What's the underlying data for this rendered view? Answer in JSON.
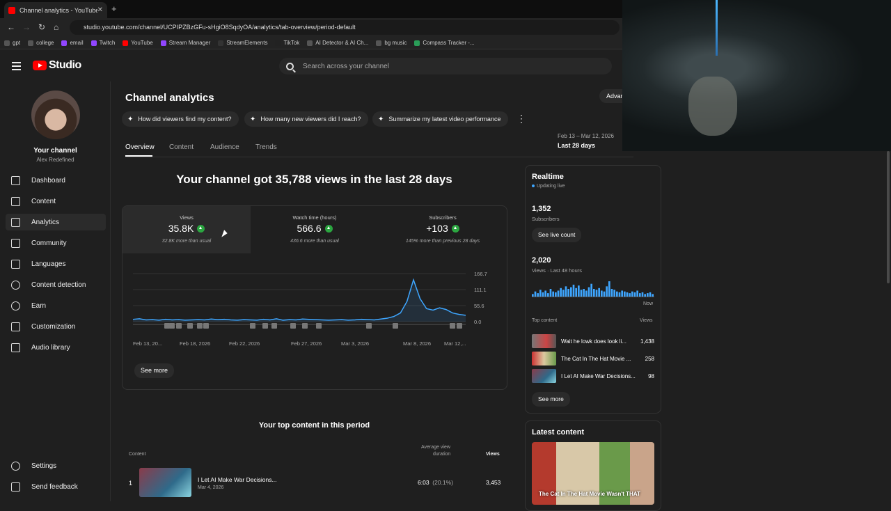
{
  "browser": {
    "tab_title": "Channel analytics - YouTube St...",
    "tab_close": "✕",
    "new_tab": "+",
    "url": "studio.youtube.com/channel/UCPIPZBzGFu-sHgiO8SqdyOA/analytics/tab-overview/period-default",
    "bookmarks": [
      "gpt",
      "college",
      "email",
      "Twitch",
      "YouTube",
      "Stream Manager",
      "StreamElements",
      "TikTok",
      "AI Detector & AI Ch...",
      "bg music",
      "Compass Tracker -..."
    ]
  },
  "header": {
    "logo_text": "Studio",
    "search_placeholder": "Search across your channel",
    "advanced_label": "Advan"
  },
  "sidebar": {
    "channel_title": "Your channel",
    "channel_name": "Alex Redefined",
    "items": [
      {
        "label": "Dashboard",
        "icon": "dashboard-icon"
      },
      {
        "label": "Content",
        "icon": "content-icon"
      },
      {
        "label": "Analytics",
        "icon": "analytics-icon",
        "active": true
      },
      {
        "label": "Community",
        "icon": "community-icon"
      },
      {
        "label": "Languages",
        "icon": "languages-icon"
      },
      {
        "label": "Content detection",
        "icon": "copyright-icon"
      },
      {
        "label": "Earn",
        "icon": "earn-icon"
      },
      {
        "label": "Customization",
        "icon": "customization-icon"
      },
      {
        "label": "Audio library",
        "icon": "audio-library-icon"
      }
    ],
    "settings": "Settings",
    "feedback": "Send feedback"
  },
  "main": {
    "page_title": "Channel analytics",
    "chips": [
      "How did viewers find my content?",
      "How many new viewers did I reach?",
      "Summarize my latest video performance"
    ],
    "more": "⋮",
    "tabs": [
      "Overview",
      "Content",
      "Audience",
      "Trends"
    ],
    "period_range": "Feb 13 – Mar 12, 2026",
    "period_label": "Last 28 days",
    "headline": "Your channel got 35,788 views in the last 28 days",
    "metrics": [
      {
        "label": "Views",
        "value": "35.8K",
        "compare": "32.8K more than usual"
      },
      {
        "label": "Watch time (hours)",
        "value": "566.6",
        "compare": "436.6 more than usual"
      },
      {
        "label": "Subscribers",
        "value": "+103",
        "compare": "145% more than previous 28 days"
      }
    ],
    "see_more": "See more",
    "top_content_title": "Your top content in this period",
    "table_headers": {
      "content": "Content",
      "avg_duration_1": "Average view",
      "avg_duration_2": "duration",
      "views": "Views"
    },
    "top_rows": [
      {
        "rank": "1",
        "title": "I Let AI Make War Decisions...",
        "date": "Mar 4, 2026",
        "duration": "6:03",
        "percent": "(20.1%)",
        "views": "3,453"
      }
    ]
  },
  "chart_data": {
    "type": "line",
    "x_tick_labels": [
      "Feb 13, 20...",
      "Feb 18, 2026",
      "Feb 22, 2026",
      "Feb 27, 2026",
      "Mar 3, 2026",
      "Mar 8, 2026",
      "Mar 12,..."
    ],
    "y_tick_labels": [
      "166.7",
      "111.1",
      "55.6",
      "0.0"
    ],
    "ylim": [
      0,
      166.7
    ],
    "series": [
      {
        "values": [
          8,
          10,
          6,
          7,
          5,
          8,
          6,
          7,
          5,
          6,
          7,
          6,
          9,
          7,
          8,
          6,
          5,
          7,
          6,
          5,
          8,
          6,
          10,
          5,
          7,
          6,
          9,
          8,
          7,
          6,
          5,
          6,
          7,
          5,
          6,
          8,
          7,
          6,
          9,
          12,
          18,
          30,
          70,
          145,
          80,
          45,
          40,
          48,
          42,
          30,
          25,
          22
        ],
        "color": "#3ea6ff"
      }
    ]
  },
  "realtime": {
    "title": "Realtime",
    "live": "Updating live",
    "subs_value": "1,352",
    "subs_label": "Subscribers",
    "live_count_btn": "See live count",
    "views_value": "2,020",
    "views_label": "Views · Last 48 hours",
    "now": "Now",
    "bars": [
      3,
      6,
      4,
      8,
      5,
      7,
      4,
      9,
      6,
      5,
      7,
      10,
      8,
      12,
      9,
      11,
      14,
      10,
      13,
      8,
      9,
      7,
      11,
      15,
      9,
      8,
      10,
      7,
      6,
      12,
      18,
      9,
      8,
      6,
      5,
      7,
      6,
      5,
      4,
      6,
      5,
      7,
      4,
      5,
      3,
      4,
      5,
      3
    ],
    "top_content_label": "Top content",
    "views_col": "Views",
    "items": [
      {
        "title": "Wait he lowk does look li...",
        "views": "1,438"
      },
      {
        "title": "The Cat In The Hat Movie ...",
        "views": "258"
      },
      {
        "title": "I Let AI Make War Decisions...",
        "views": "98"
      }
    ],
    "see_more": "See more"
  },
  "latest": {
    "title": "Latest content",
    "caption": "The Cat In The Hat Movie Wasn't THAT"
  }
}
